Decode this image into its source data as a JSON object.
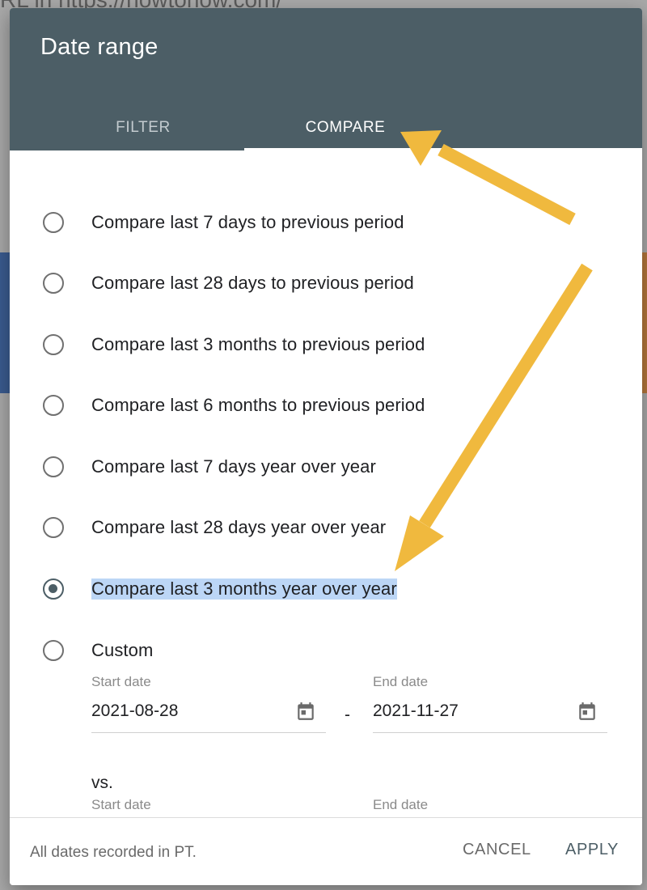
{
  "background": {
    "url_fragment": "RL in  https://howtohow.com/"
  },
  "dialog": {
    "title": "Date range",
    "tabs": [
      {
        "label": "FILTER",
        "active": false
      },
      {
        "label": "COMPARE",
        "active": true
      }
    ],
    "options": [
      {
        "label": "Compare last 7 days to previous period",
        "checked": false
      },
      {
        "label": "Compare last 28 days to previous period",
        "checked": false
      },
      {
        "label": "Compare last 3 months to previous period",
        "checked": false
      },
      {
        "label": "Compare last 6 months to previous period",
        "checked": false
      },
      {
        "label": "Compare last 7 days year over year",
        "checked": false
      },
      {
        "label": "Compare last 28 days year over year",
        "checked": false
      },
      {
        "label": "Compare last 3 months year over year",
        "checked": true
      },
      {
        "label": "Custom",
        "checked": false
      }
    ],
    "custom": {
      "start_label": "Start date",
      "start_value": "2021-08-28",
      "end_label": "End date",
      "end_value": "2021-11-27",
      "separator": "-",
      "vs_label": "vs.",
      "vs_start_label": "Start date",
      "vs_end_label": "End date"
    },
    "footer": {
      "note": "All dates recorded in PT.",
      "cancel_label": "CANCEL",
      "apply_label": "APPLY"
    }
  },
  "colors": {
    "header": "#4c5e66",
    "selection_highlight": "#bcd6f6",
    "annotation_arrow": "#f0b93e"
  }
}
